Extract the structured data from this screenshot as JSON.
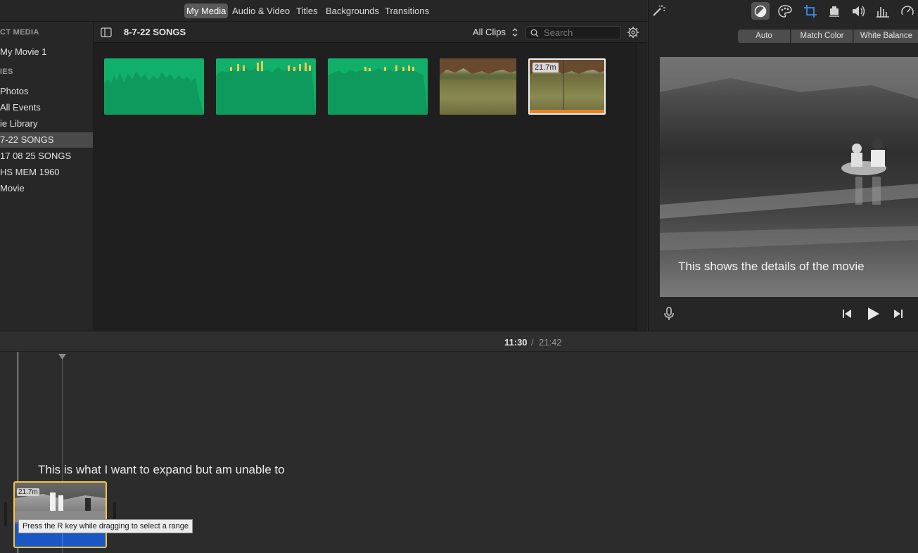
{
  "tabs": [
    {
      "label": "My Media",
      "active": true
    },
    {
      "label": "Audio & Video",
      "active": false
    },
    {
      "label": "Titles",
      "active": false
    },
    {
      "label": "Backgrounds",
      "active": false
    },
    {
      "label": "Transitions",
      "active": false
    }
  ],
  "sidebar": {
    "project_media_header": "CT MEDIA",
    "project_item": "My Movie 1",
    "libraries_header": "IES",
    "items": [
      {
        "label": "Photos",
        "selected": false
      },
      {
        "label": "All Events",
        "selected": false
      },
      {
        "label": "ie Library",
        "selected": false
      },
      {
        "label": "7-22 SONGS",
        "selected": true
      },
      {
        "label": "17 08 25 SONGS",
        "selected": false
      },
      {
        "label": "HS MEM 1960",
        "selected": false
      },
      {
        "label": "Movie",
        "selected": false
      }
    ]
  },
  "browser": {
    "title": "8-7-22 SONGS",
    "filter_label": "All Clips",
    "search_placeholder": "Search",
    "selected_clip_duration": "21.7m"
  },
  "viewer": {
    "buttons": [
      "Auto",
      "Match Color",
      "White Balance"
    ],
    "overlay_text": "This shows the details of the movie"
  },
  "timeline": {
    "current_time": "11:30",
    "separator": "/",
    "total_time": "21:42",
    "annotation": "This is what I want to expand but am unable to",
    "clip_duration": "21.7m",
    "tooltip": "Press the R key while dragging to select a range"
  },
  "colors": {
    "audio_clip": "#10b06a",
    "waveform_peak": "#f2c94c",
    "selection_yellow": "#f5c542",
    "timeline_blue": "#1a56c4",
    "accent_blue": "#3a8ee6"
  }
}
